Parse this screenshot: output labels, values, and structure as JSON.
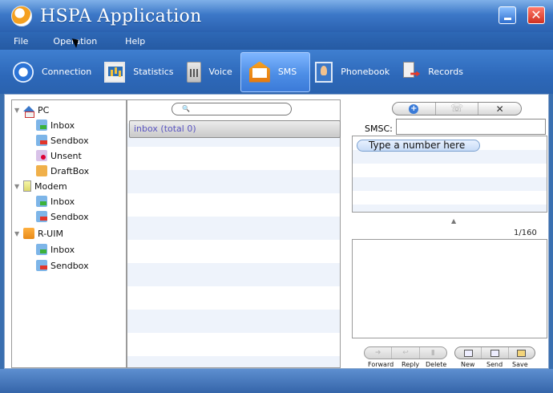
{
  "window": {
    "title": "HSPA Application",
    "minimize_icon": "minimize-icon",
    "close_icon": "close-icon",
    "close_glyph": "✕"
  },
  "menu": [
    "File",
    "Operation",
    "Help"
  ],
  "toolbar": {
    "active": "SMS",
    "items": [
      {
        "label": "Connection",
        "icon": "connection-icon"
      },
      {
        "label": "Statistics",
        "icon": "statistics-icon"
      },
      {
        "label": "Voice",
        "icon": "voice-icon"
      },
      {
        "label": "SMS",
        "icon": "sms-icon"
      },
      {
        "label": "Phonebook",
        "icon": "phonebook-icon"
      },
      {
        "label": "Records",
        "icon": "records-icon"
      }
    ]
  },
  "tree": {
    "pc": {
      "label": "PC",
      "children": [
        "Inbox",
        "Sendbox",
        "Unsent",
        "DraftBox"
      ]
    },
    "modem": {
      "label": "Modem",
      "children": [
        "Inbox",
        "Sendbox"
      ]
    },
    "ruim": {
      "label": "R-UIM",
      "children": [
        "Inbox",
        "Sendbox"
      ]
    }
  },
  "messages": {
    "search_glyph": "🔍",
    "header": "inbox (total 0)"
  },
  "compose": {
    "smsc_label": "SMSC:",
    "smsc_value": "",
    "number_placeholder": "Type a number here",
    "counter": "1/160",
    "add_glyph": "+",
    "remove_glyph": "✕",
    "buttons": [
      "Forward",
      "Reply",
      "Delete",
      "New",
      "Send",
      "Save"
    ]
  },
  "colors": {
    "chrome_blue": "#2d68b9",
    "active_tab": "#4d8ee6",
    "inbox_header_text": "#5a55c0"
  }
}
